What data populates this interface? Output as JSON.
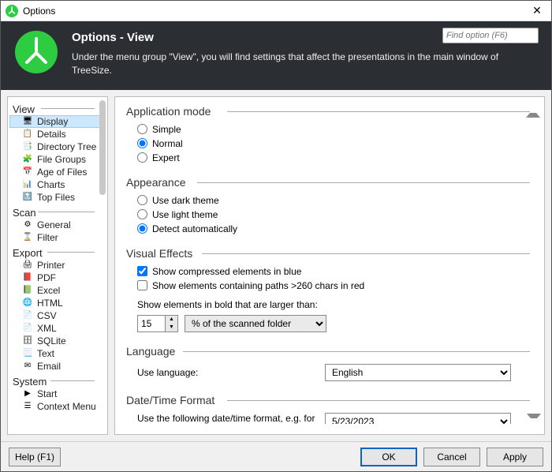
{
  "window": {
    "title": "Options"
  },
  "header": {
    "title": "Options - View",
    "description": "Under the menu group \"View\", you will find settings that affect the presentations in the main window of TreeSize.",
    "search_placeholder": "Find option (F6)"
  },
  "sidebar": {
    "groups": [
      {
        "title": "View",
        "items": [
          {
            "label": "Display",
            "icon": "🖥",
            "selected": true
          },
          {
            "label": "Details",
            "icon": "📋"
          },
          {
            "label": "Directory Tree",
            "icon": "📑"
          },
          {
            "label": "File Groups",
            "icon": "🧩"
          },
          {
            "label": "Age of Files",
            "icon": "📅"
          },
          {
            "label": "Charts",
            "icon": "📊"
          },
          {
            "label": "Top Files",
            "icon": "🔝"
          }
        ]
      },
      {
        "title": "Scan",
        "items": [
          {
            "label": "General",
            "icon": "⚙"
          },
          {
            "label": "Filter",
            "icon": "⌛"
          }
        ]
      },
      {
        "title": "Export",
        "items": [
          {
            "label": "Printer",
            "icon": "🖨"
          },
          {
            "label": "PDF",
            "icon": "📕"
          },
          {
            "label": "Excel",
            "icon": "📗"
          },
          {
            "label": "HTML",
            "icon": "🌐"
          },
          {
            "label": "CSV",
            "icon": "📄"
          },
          {
            "label": "XML",
            "icon": "📄"
          },
          {
            "label": "SQLite",
            "icon": "🗄"
          },
          {
            "label": "Text",
            "icon": "📃"
          },
          {
            "label": "Email",
            "icon": "✉"
          }
        ]
      },
      {
        "title": "System",
        "items": [
          {
            "label": "Start",
            "icon": "▶"
          },
          {
            "label": "Context Menu",
            "icon": "☰"
          }
        ]
      }
    ]
  },
  "content": {
    "app_mode": {
      "title": "Application mode",
      "options": [
        "Simple",
        "Normal",
        "Expert"
      ],
      "selected": "Normal"
    },
    "appearance": {
      "title": "Appearance",
      "options": [
        "Use dark theme",
        "Use light theme",
        "Detect automatically"
      ],
      "selected": "Detect automatically"
    },
    "visual": {
      "title": "Visual Effects",
      "cb1": "Show compressed elements in blue",
      "cb1_checked": true,
      "cb2": "Show elements containing paths >260 chars in red",
      "cb2_checked": false,
      "bold_label": "Show elements in bold that are larger than:",
      "bold_value": "15",
      "bold_unit_options": [
        "% of the scanned folder"
      ],
      "bold_unit": "% of the scanned folder"
    },
    "language": {
      "title": "Language",
      "label": "Use language:",
      "options": [
        "English"
      ],
      "value": "English"
    },
    "datetime": {
      "title": "Date/Time Format",
      "label": "Use the following date/time format, e.g. for",
      "value": "5/23/2023"
    }
  },
  "buttons": {
    "help": "Help (F1)",
    "ok": "OK",
    "cancel": "Cancel",
    "apply": "Apply"
  }
}
